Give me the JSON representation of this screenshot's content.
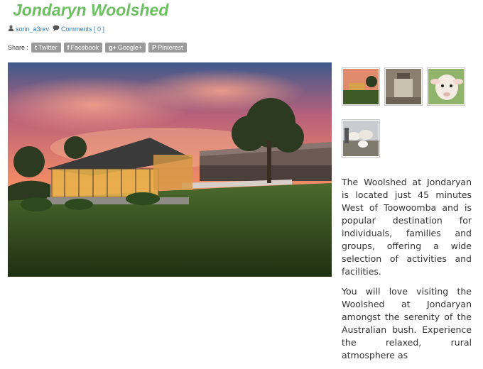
{
  "post": {
    "title": "Jondaryn Woolshed",
    "author": "sorin_a3rev",
    "comments": "Comments [ 0 ]"
  },
  "share": {
    "label": "Share :",
    "buttons": [
      {
        "icon": "twitter-icon",
        "glyph": "t",
        "label": "Twitter"
      },
      {
        "icon": "facebook-icon",
        "glyph": "f",
        "label": "Facebook"
      },
      {
        "icon": "google-plus-icon",
        "glyph": "g+",
        "label": "Google+"
      },
      {
        "icon": "pinterest-icon",
        "glyph": "P",
        "label": "Pinterest"
      }
    ]
  },
  "gallery": {
    "thumbnails": [
      "woolshed-sunset",
      "wool-press",
      "lamb",
      "sheep-flock"
    ]
  },
  "body": {
    "paragraphs": [
      "The Woolshed at Jondaryan is located just 45 minutes West of Toowoomba and is popular destination for individuals, families and groups, offering a wide selection of activities and facilities.",
      "You will love visiting the Woolshed at Jondaryan amongst the serenity of the Australian bush. Experience the relaxed, rural atmosphere as"
    ]
  },
  "colors": {
    "title": "#6cbf61",
    "link": "#2a7ab8",
    "share_button": "#9a9a9a"
  }
}
